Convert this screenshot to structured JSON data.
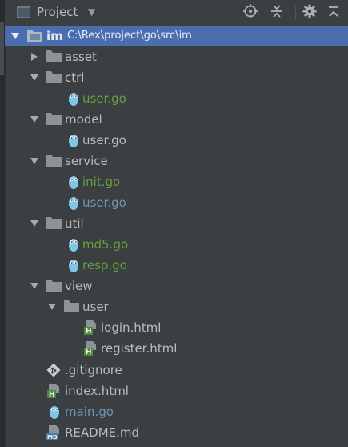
{
  "window": {
    "title": "Project",
    "icons": {
      "project": "project-view-icon",
      "dropdown": "chevron-down-icon",
      "locate": "crosshair-icon",
      "collapse": "collapse-all-icon",
      "settings": "gear-icon",
      "hide": "hide-panel-icon"
    }
  },
  "tree": {
    "root": {
      "name": "im",
      "path": "C:\\Rex\\project\\go\\src\\im"
    },
    "items": [
      {
        "label": "asset",
        "kind": "folder",
        "expanded": false
      },
      {
        "label": "ctrl",
        "kind": "folder",
        "expanded": true
      },
      {
        "label": "user.go",
        "kind": "go",
        "status": "added"
      },
      {
        "label": "model",
        "kind": "folder",
        "expanded": true
      },
      {
        "label": "user.go",
        "kind": "go",
        "status": "unchanged"
      },
      {
        "label": "service",
        "kind": "folder",
        "expanded": true
      },
      {
        "label": "init.go",
        "kind": "go",
        "status": "added"
      },
      {
        "label": "user.go",
        "kind": "go",
        "status": "modified"
      },
      {
        "label": "util",
        "kind": "folder",
        "expanded": true
      },
      {
        "label": "md5.go",
        "kind": "go",
        "status": "added"
      },
      {
        "label": "resp.go",
        "kind": "go",
        "status": "added"
      },
      {
        "label": "view",
        "kind": "folder",
        "expanded": true
      },
      {
        "label": "user",
        "kind": "folder",
        "expanded": true
      },
      {
        "label": "login.html",
        "kind": "html",
        "status": "unchanged"
      },
      {
        "label": "register.html",
        "kind": "html",
        "status": "unchanged"
      },
      {
        "label": ".gitignore",
        "kind": "git",
        "status": "unchanged"
      },
      {
        "label": "index.html",
        "kind": "html",
        "status": "unchanged"
      },
      {
        "label": "main.go",
        "kind": "go",
        "status": "modified"
      },
      {
        "label": "README.md",
        "kind": "md",
        "status": "unchanged"
      }
    ]
  },
  "colors": {
    "panel_bg": "#3c3f41",
    "selection": "#4b6eaf",
    "text": "#bbbbbb",
    "added": "#62a03c",
    "modified": "#6897bb",
    "folder": "#8c9499",
    "go_icon": "#7fc7e8"
  }
}
